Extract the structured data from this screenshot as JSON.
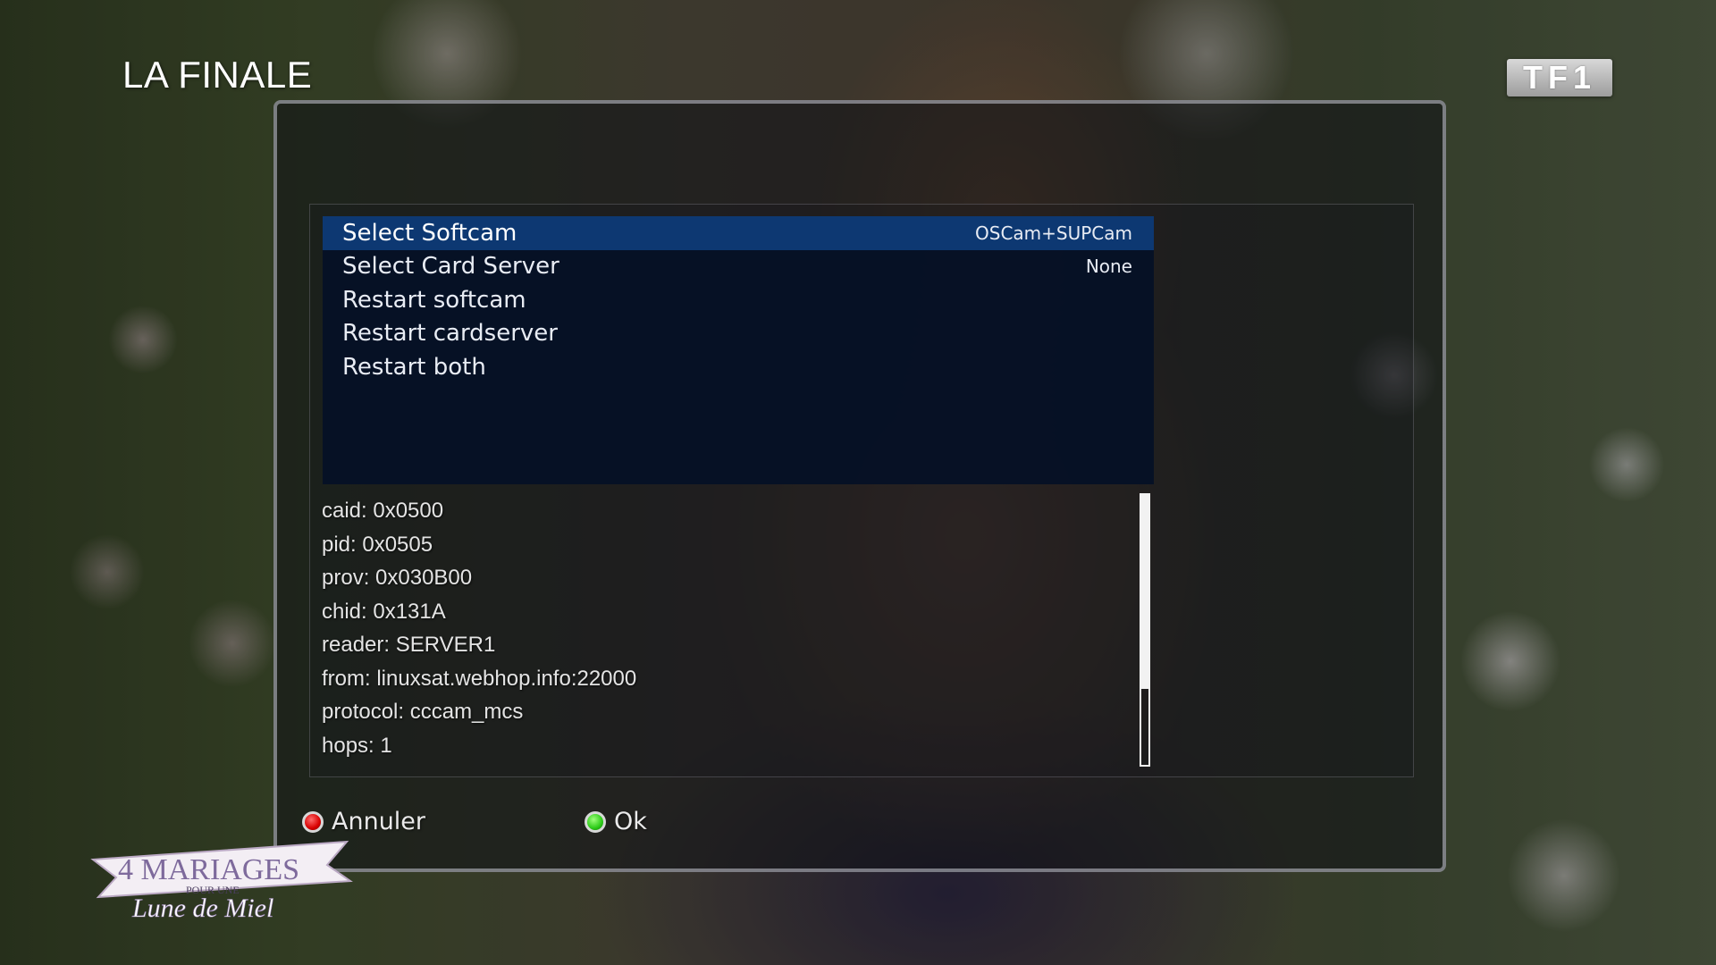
{
  "screen": {
    "program_title": "LA FINALE",
    "channel_logo": "TF1"
  },
  "menu": {
    "items": [
      {
        "label": "Select Softcam",
        "value": "OSCam+SUPCam",
        "selected": true
      },
      {
        "label": "Select Card Server",
        "value": "None",
        "selected": false
      },
      {
        "label": "Restart softcam",
        "value": "",
        "selected": false
      },
      {
        "label": "Restart cardserver",
        "value": "",
        "selected": false
      },
      {
        "label": "Restart both",
        "value": "",
        "selected": false
      }
    ]
  },
  "info": {
    "lines": [
      "caid: 0x0500",
      "pid: 0x0505",
      "prov: 0x030B00",
      "chid: 0x131A",
      "reader: SERVER1",
      "from: linuxsat.webhop.info:22000",
      "protocol: cccam_mcs",
      "hops: 1"
    ],
    "scroll_fraction": 0.72
  },
  "buttons": {
    "cancel": {
      "label": "Annuler",
      "color": "#e00000"
    },
    "ok": {
      "label": "Ok",
      "color": "#2ccb18"
    }
  },
  "show_logo": {
    "line1": "4 MARIAGES",
    "line2": "POUR UNE",
    "line3": "Lune de Miel"
  },
  "colors": {
    "selection": "#0d3872",
    "menu_background": "#04102a"
  }
}
